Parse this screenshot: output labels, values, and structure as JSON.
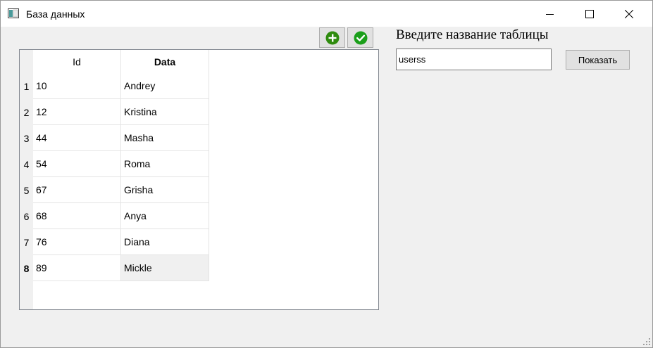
{
  "window": {
    "title": "База данных",
    "icons": {
      "app": "database-app-icon",
      "minimize": "minimize-icon",
      "maximize": "maximize-icon",
      "close": "close-icon"
    }
  },
  "toolbar": {
    "add_icon": "add-circle-icon",
    "add_color": "#2e8b0e",
    "confirm_icon": "checkmark-circle-icon",
    "confirm_color": "#1a9e1a"
  },
  "table": {
    "columns": [
      "Id",
      "Data"
    ],
    "rows": [
      {
        "num": "1",
        "id": "10",
        "data": "Andrey"
      },
      {
        "num": "2",
        "id": "12",
        "data": "Kristina"
      },
      {
        "num": "3",
        "id": "44",
        "data": "Masha"
      },
      {
        "num": "4",
        "id": "54",
        "data": "Roma"
      },
      {
        "num": "5",
        "id": "67",
        "data": "Grisha"
      },
      {
        "num": "6",
        "id": "68",
        "data": "Anya"
      },
      {
        "num": "7",
        "id": "76",
        "data": "Diana"
      },
      {
        "num": "8",
        "id": "89",
        "data": "Mickle"
      }
    ],
    "current_row": "8"
  },
  "panel": {
    "prompt": "Введите название таблицы",
    "table_name_value": "userss",
    "show_button_label": "Показать"
  }
}
